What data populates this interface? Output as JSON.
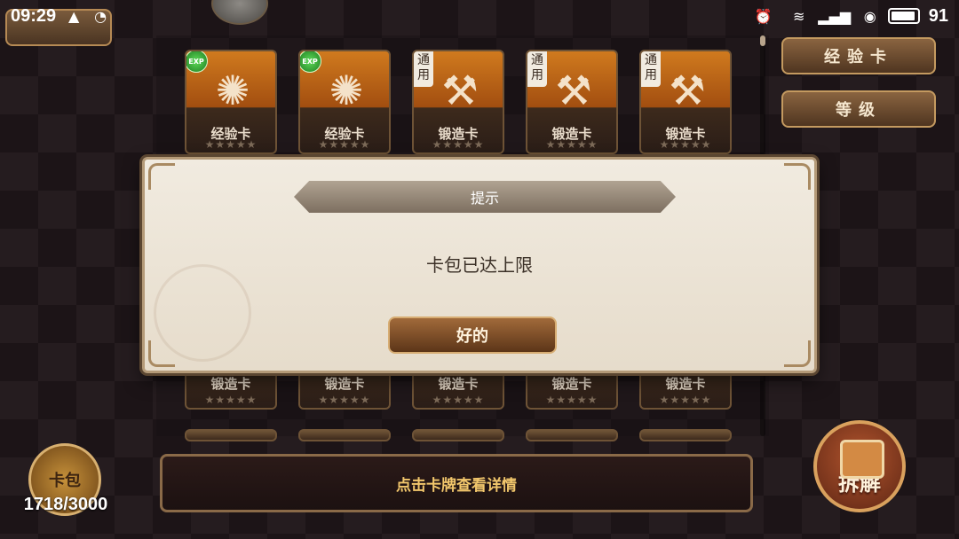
{
  "status_bar": {
    "time": "09:29",
    "battery_level": "91"
  },
  "cards_row1": [
    {
      "name": "经验卡",
      "badge": "EXP",
      "stars": "★★★★★",
      "emblem": "✺"
    },
    {
      "name": "经验卡",
      "badge": "EXP",
      "stars": "★★★★★",
      "emblem": "✺"
    },
    {
      "name": "锻造卡",
      "badge": "通用",
      "stars": "★★★★★",
      "emblem": "⚒"
    },
    {
      "name": "锻造卡",
      "badge": "通用",
      "stars": "★★★★★",
      "emblem": "⚒"
    },
    {
      "name": "锻造卡",
      "badge": "通用",
      "stars": "★★★★★",
      "emblem": "⚒"
    }
  ],
  "cards_row2": [
    {
      "name": "锻造卡",
      "stars": "★★★★★"
    },
    {
      "name": "锻造卡",
      "stars": "★★★★★"
    },
    {
      "name": "锻造卡",
      "stars": "★★★★★"
    },
    {
      "name": "锻造卡",
      "stars": "★★★★★"
    },
    {
      "name": "锻造卡",
      "stars": "★★★★★"
    }
  ],
  "sort_buttons": {
    "exp_card": "经验卡",
    "level": "等级"
  },
  "bottom": {
    "pack_label": "卡包",
    "pack_count": "1718/3000",
    "hint": "点击卡牌查看详情",
    "decompose_label": "拆解"
  },
  "dialog": {
    "title": "提示",
    "message": "卡包已达上限",
    "ok_label": "好的"
  }
}
